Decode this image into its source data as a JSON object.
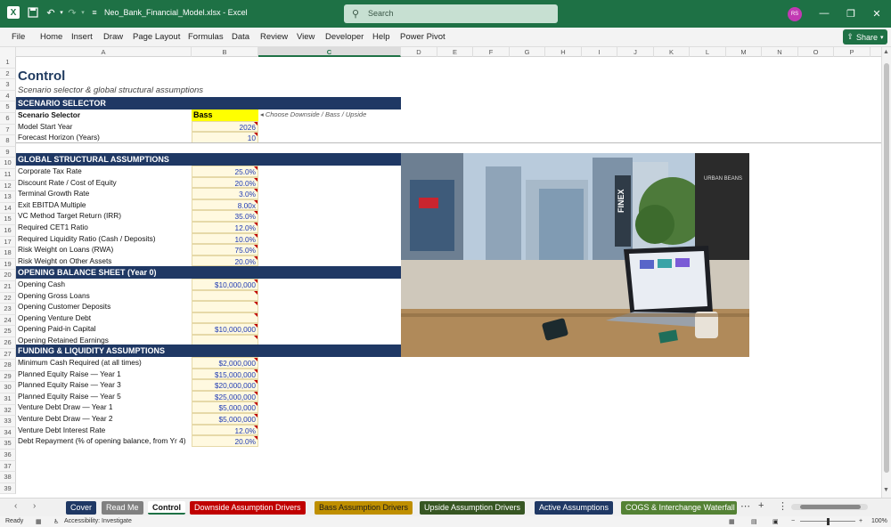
{
  "window": {
    "doc_title": "Neo_Bank_Financial_Model.xlsx  -  Excel",
    "search_placeholder": "Search",
    "avatar_initials": "RS",
    "accent_color": "#1e7145"
  },
  "menu": {
    "items": [
      "File",
      "Home",
      "Insert",
      "Draw",
      "Page Layout",
      "Formulas",
      "Data",
      "Review",
      "View",
      "Developer",
      "Help",
      "Power Pivot"
    ],
    "share_label": "Share"
  },
  "columns": [
    "A",
    "B",
    "C",
    "D",
    "E",
    "F",
    "G",
    "H",
    "I",
    "J",
    "K",
    "L",
    "M",
    "N",
    "O",
    "P"
  ],
  "rows": [
    "1",
    "2",
    "3",
    "4",
    "5",
    "6",
    "7",
    "8",
    "9",
    "10",
    "11",
    "12",
    "13",
    "14",
    "15",
    "16",
    "17",
    "18",
    "19",
    "20",
    "21",
    "22",
    "23",
    "24",
    "25",
    "26",
    "27",
    "28",
    "29",
    "30",
    "31",
    "32",
    "33",
    "34",
    "35",
    "36",
    "37",
    "38",
    "39"
  ],
  "sheet": {
    "title": "Control",
    "subtitle": "Scenario selector & global structural assumptions",
    "scenario_header": "SCENARIO SELECTOR",
    "scenario_label": "Scenario Selector",
    "scenario_value": "Bass",
    "scenario_hint": "◂ Choose Downside / Bass / Upside",
    "start_year_label": "Model Start Year",
    "start_year_value": "2026",
    "horizon_label": "Forecast Horizon (Years)",
    "horizon_value": "10",
    "global_header": "GLOBAL STRUCTURAL ASSUMPTIONS",
    "global_rows": [
      {
        "label": "Corporate Tax Rate",
        "value": "25.0%"
      },
      {
        "label": "Discount Rate / Cost of Equity",
        "value": "20.0%"
      },
      {
        "label": "Terminal Growth Rate",
        "value": "3.0%"
      },
      {
        "label": "Exit EBITDA Multiple",
        "value": "8.00x"
      },
      {
        "label": "VC Method Target Return (IRR)",
        "value": "35.0%"
      },
      {
        "label": "Required CET1 Ratio",
        "value": "12.0%"
      },
      {
        "label": "Required Liquidity Ratio (Cash / Deposits)",
        "value": "10.0%"
      },
      {
        "label": "Risk Weight on Loans (RWA)",
        "value": "75.0%"
      },
      {
        "label": "Risk Weight on Other Assets",
        "value": "20.0%"
      }
    ],
    "opening_header": "OPENING BALANCE SHEET (Year 0)",
    "opening_rows": [
      {
        "label": "Opening Cash",
        "value": "$10,000,000"
      },
      {
        "label": "Opening Gross Loans",
        "value": ""
      },
      {
        "label": "Opening Customer Deposits",
        "value": ""
      },
      {
        "label": "Opening Venture Debt",
        "value": ""
      },
      {
        "label": "Opening Paid-in Capital",
        "value": "$10,000,000"
      },
      {
        "label": "Opening Retained Earnings",
        "value": ""
      }
    ],
    "funding_header": "FUNDING & LIQUIDITY ASSUMPTIONS",
    "funding_rows": [
      {
        "label": "Minimum Cash Required (at all times)",
        "value": "$2,000,000"
      },
      {
        "label": "Planned Equity Raise — Year 1",
        "value": "$15,000,000"
      },
      {
        "label": "Planned Equity Raise — Year 3",
        "value": "$20,000,000"
      },
      {
        "label": "Planned Equity Raise — Year 5",
        "value": "$25,000,000"
      },
      {
        "label": "Venture Debt Draw — Year 1",
        "value": "$5,000,000"
      },
      {
        "label": "Venture Debt Draw — Year 2",
        "value": "$5,000,000"
      },
      {
        "label": "Venture Debt Interest Rate",
        "value": "12.0%"
      },
      {
        "label": "Debt Repayment (% of opening balance, from Yr 4)",
        "value": "20.0%"
      }
    ]
  },
  "photo": {
    "storefront_sign": "FINEX",
    "corner_sign": "URBAN BEANS"
  },
  "tabs": [
    {
      "label": "Cover",
      "bg": "#1f3864",
      "fg": "#ffffff"
    },
    {
      "label": "Read Me",
      "bg": "#808080",
      "fg": "#ffffff"
    },
    {
      "label": "Control",
      "bg": "#ffffff",
      "fg": "#111111",
      "active": true
    },
    {
      "label": "Downside Assumption Drivers",
      "bg": "#c00000",
      "fg": "#ffffff"
    },
    {
      "label": "Bass Assumption Drivers",
      "bg": "#bf8f00",
      "fg": "#1a1a1a"
    },
    {
      "label": "Upside Assumption Drivers",
      "bg": "#375623",
      "fg": "#ffffff"
    },
    {
      "label": "Active Assumptions",
      "bg": "#1f3864",
      "fg": "#ffffff"
    },
    {
      "label": "COGS & Interchange Waterfall",
      "bg": "#548235",
      "fg": "#ffffff"
    }
  ],
  "status": {
    "ready": "Ready",
    "accessibility": "Accessibility: Investigate",
    "zoom": "100%"
  }
}
